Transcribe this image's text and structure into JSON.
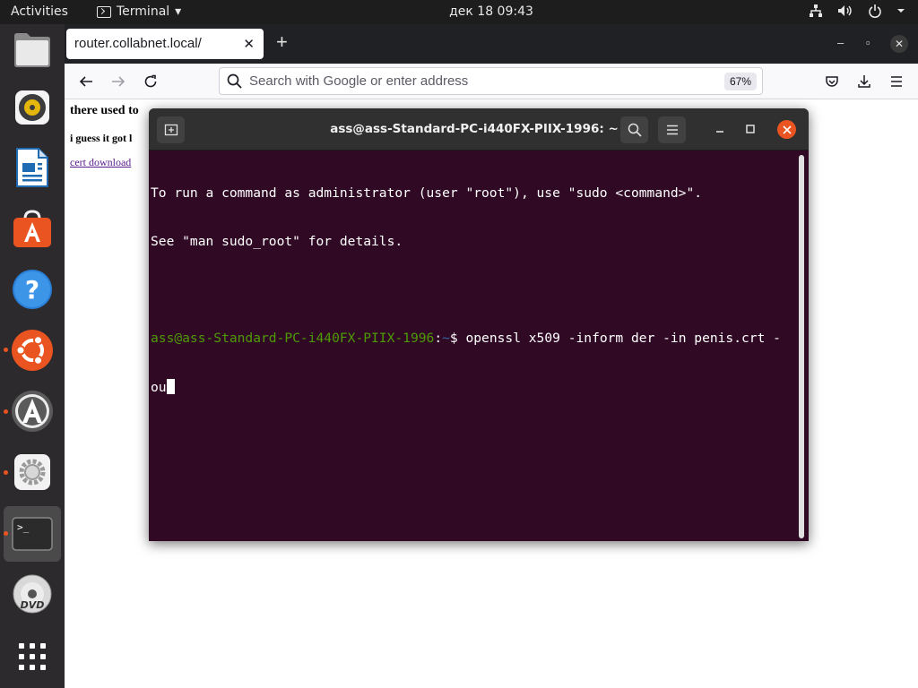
{
  "topbar": {
    "activities": "Activities",
    "app_name": "Terminal",
    "clock": "дек 18  09:43"
  },
  "dock": {
    "items": [
      {
        "name": "files"
      },
      {
        "name": "rhythmbox"
      },
      {
        "name": "libreoffice-writer"
      },
      {
        "name": "software-center"
      },
      {
        "name": "help"
      },
      {
        "name": "ubuntu"
      },
      {
        "name": "software-updater"
      },
      {
        "name": "settings"
      },
      {
        "name": "terminal"
      },
      {
        "name": "dvd"
      },
      {
        "name": "show-applications"
      }
    ]
  },
  "browser": {
    "tab_title": "router.collabnet.local/",
    "url_placeholder": "Search with Google or enter address",
    "zoom": "67%",
    "page": {
      "heading": "there used to",
      "sub": "i guess it got l",
      "link": "cert download"
    }
  },
  "terminal": {
    "title": "ass@ass-Standard-PC-i440FX-PIIX-1996: ~",
    "line1": "To run a command as administrator (user \"root\"), use \"sudo <command>\".",
    "line2": "See \"man sudo_root\" for details.",
    "prompt_user": "ass@ass-Standard-PC-i440FX-PIIX-1996",
    "prompt_sep": ":",
    "prompt_path": "~",
    "prompt_sign": "$ ",
    "command": "openssl x509 -inform der -in penis.crt -",
    "command_wrap": "ou"
  },
  "colors": {
    "terminal_bg": "#300a24",
    "ubuntu_orange": "#e95420",
    "prompt_green": "#4e9a06",
    "prompt_blue": "#3465a4"
  }
}
